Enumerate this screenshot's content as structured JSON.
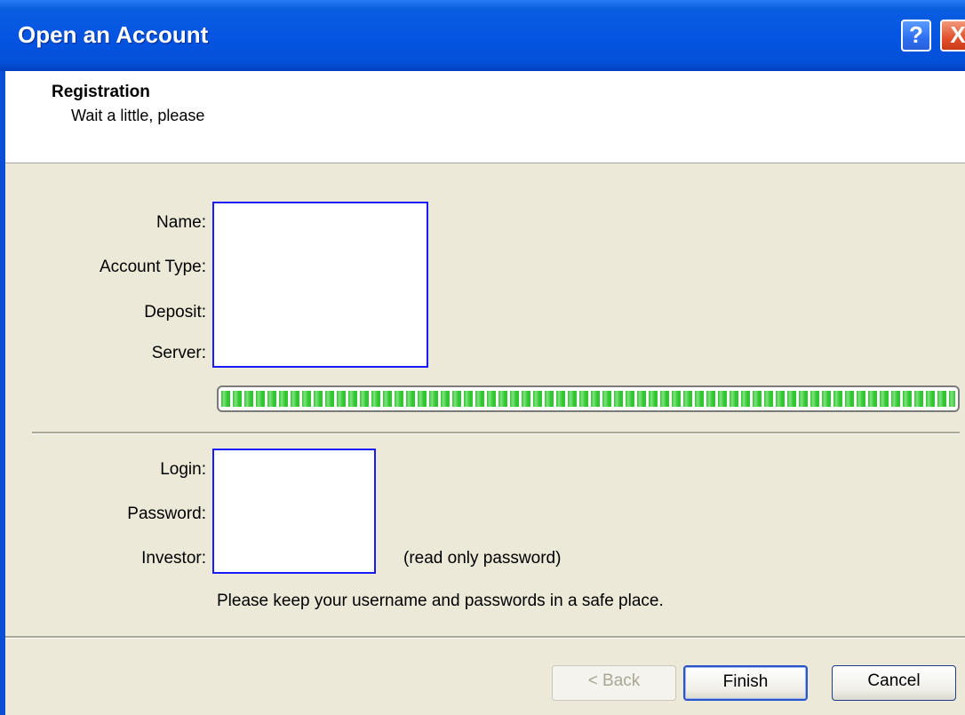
{
  "window": {
    "title": "Open an Account",
    "help_glyph": "?",
    "close_glyph": "X"
  },
  "header": {
    "title": "Registration",
    "subtitle": "Wait a little, please"
  },
  "account": {
    "name_label": "Name:",
    "account_type_label": "Account Type:",
    "deposit_label": "Deposit:",
    "server_label": "Server:",
    "name_value": "",
    "account_type_value": "",
    "deposit_value": "",
    "server_value": ""
  },
  "progress": {
    "value_percent": 100,
    "color": "#2fc62f"
  },
  "credentials": {
    "login_label": "Login:",
    "password_label": "Password:",
    "investor_label": "Investor:",
    "login_value": "",
    "password_value": "",
    "investor_value": "",
    "investor_note": "(read only password)",
    "safe_note": "Please keep your username and passwords in a safe place."
  },
  "buttons": {
    "back": "< Back",
    "finish": "Finish",
    "cancel": "Cancel"
  },
  "colors": {
    "title_bar": "#0554e3",
    "field_border": "#1a1aff",
    "dialog_bg": "#ece9d8"
  }
}
